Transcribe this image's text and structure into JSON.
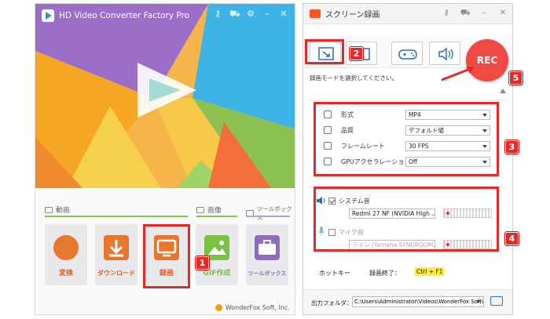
{
  "left_window": {
    "title": "HD Video Converter Factory Pro",
    "controls": [
      "key-icon",
      "cart-icon",
      "settings-icon",
      "minimize-icon",
      "close-icon"
    ],
    "categories": [
      {
        "label": "動画",
        "color": "#8bc34a"
      },
      {
        "label": "画像",
        "color": "#8bc34a"
      },
      {
        "label": "ツールボックス",
        "color": "#b39ddb"
      }
    ],
    "tools": [
      {
        "label": "変換",
        "icon": "film-reel-icon",
        "color": "#e8772e"
      },
      {
        "label": "ダウンロード",
        "icon": "download-icon",
        "color": "#e8772e"
      },
      {
        "label": "録画",
        "icon": "screen-record-icon",
        "color": "#e8772e"
      },
      {
        "label": "GIF作成",
        "icon": "image-icon",
        "color": "#7ac143"
      },
      {
        "label": "ツールボックス",
        "icon": "toolbox-icon",
        "color": "#8e6dbf"
      }
    ],
    "footer": "WonderFox Soft, Inc."
  },
  "right_window": {
    "title": "スクリーン録画",
    "title_buttons": [
      "key-icon",
      "cart-icon",
      "minimize-icon",
      "close-icon"
    ],
    "modes": [
      "custom-area-icon",
      "fullscreen-icon",
      "game-icon",
      "audio-icon"
    ],
    "rec_label": "REC",
    "hint": "録画モードを選択してください。",
    "settings": [
      {
        "label": "形式",
        "value": "MP4"
      },
      {
        "label": "品質",
        "value": "デフォルト値"
      },
      {
        "label": "フレームレート",
        "value": "30 FPS"
      },
      {
        "label": "GPUアクセラレーション",
        "value": "Off"
      }
    ],
    "audio": {
      "system": {
        "label": "システム音",
        "checked": true,
        "device": "Redmi 27 NF (NVIDIA High ..."
      },
      "mic": {
        "label": "マイク音",
        "checked": false,
        "device": "ライン (Yamaha SYNCROOM..."
      }
    },
    "hotkey_label": "ホットキー",
    "hotkey_action": "録画終了：",
    "hotkey_value": "Ctrl + F1",
    "output_label": "出力フォルダ：",
    "output_path": "C:\\Users\\Administrator\\Videos\\WonderFox Soft\\HD V..."
  },
  "annotations": [
    "1",
    "2",
    "3",
    "4",
    "5"
  ],
  "colors": {
    "accent_red": "#e12b2b",
    "rec": "#f04a46",
    "orange": "#e8772e"
  }
}
